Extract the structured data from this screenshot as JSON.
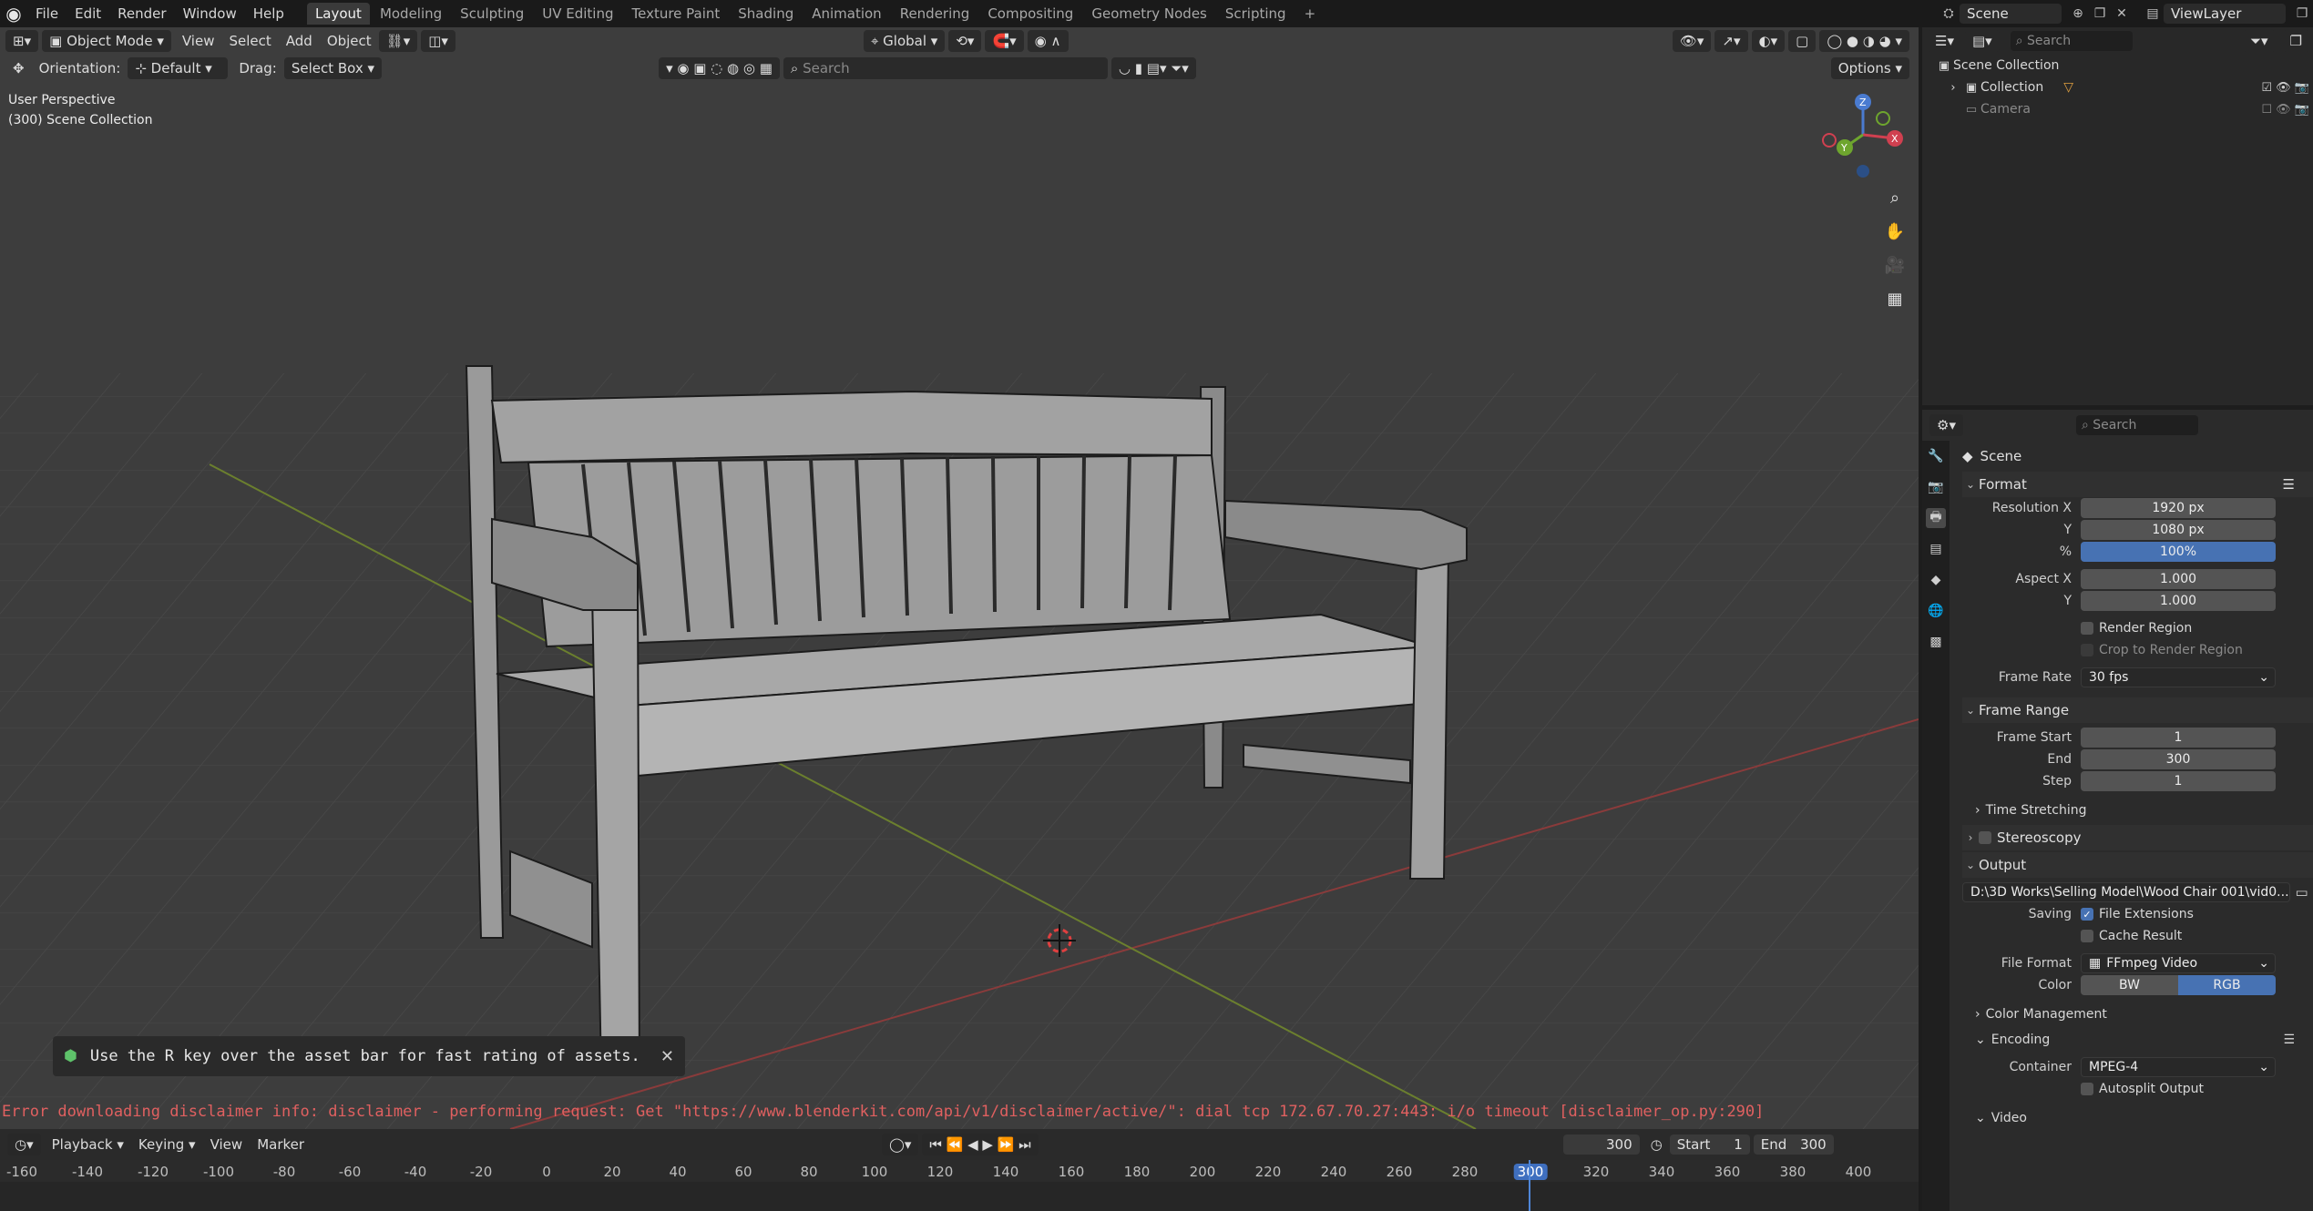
{
  "topbar": {
    "menus": [
      "File",
      "Edit",
      "Render",
      "Window",
      "Help"
    ],
    "workspaces": [
      "Layout",
      "Modeling",
      "Sculpting",
      "UV Editing",
      "Texture Paint",
      "Shading",
      "Animation",
      "Rendering",
      "Compositing",
      "Geometry Nodes",
      "Scripting",
      "+"
    ],
    "active_workspace": "Layout",
    "scene": "Scene",
    "view_layer": "ViewLayer"
  },
  "viewport": {
    "mode": "Object Mode",
    "menus": [
      "View",
      "Select",
      "Add",
      "Object"
    ],
    "transform": "Global",
    "orientation_label": "Orientation:",
    "orientation_value": "Default",
    "drag_label": "Drag:",
    "drag_value": "Select Box",
    "search_placeholder": "Search",
    "options": "Options",
    "perspective": "User Perspective",
    "collection": "(300) Scene Collection"
  },
  "notice": {
    "text": "Use the R key over the asset bar for fast rating of assets.",
    "close": "✕"
  },
  "error": "Error downloading disclaimer info: disclaimer - performing request: Get \"https://www.blenderkit.com/api/v1/disclaimer/active/\": dial tcp 172.67.70.27:443: i/o timeout [disclaimer_op.py:290]",
  "timeline": {
    "menus": [
      "Playback",
      "Keying",
      "View",
      "Marker"
    ],
    "current_frame": "300",
    "start_label": "Start",
    "start": "1",
    "end_label": "End",
    "end": "300",
    "ticks": [
      "-160",
      "-140",
      "-120",
      "-100",
      "-80",
      "-60",
      "-40",
      "-20",
      "0",
      "20",
      "40",
      "60",
      "80",
      "100",
      "120",
      "140",
      "160",
      "180",
      "200",
      "220",
      "240",
      "260",
      "280",
      "300",
      "320",
      "340",
      "360",
      "380",
      "400"
    ]
  },
  "outliner": {
    "search_placeholder": "Search",
    "items": [
      {
        "label": "Scene Collection"
      },
      {
        "label": "Collection"
      },
      {
        "label": "Camera"
      }
    ]
  },
  "properties": {
    "search_placeholder": "Search",
    "title": "Scene",
    "format": {
      "label": "Format",
      "resolution_x_label": "Resolution X",
      "resolution_x": "1920 px",
      "y_label": "Y",
      "resolution_y": "1080 px",
      "pct_label": "%",
      "pct": "100%",
      "aspect_x_label": "Aspect X",
      "aspect_x": "1.000",
      "aspect_y_label": "Y",
      "aspect_y": "1.000",
      "render_region": "Render Region",
      "crop": "Crop to Render Region",
      "frame_rate_label": "Frame Rate",
      "frame_rate": "30 fps"
    },
    "frame_range": {
      "label": "Frame Range",
      "start_label": "Frame Start",
      "start": "1",
      "end_label": "End",
      "end": "300",
      "step_label": "Step",
      "step": "1",
      "time_stretching": "Time Stretching"
    },
    "stereoscopy": "Stereoscopy",
    "output": {
      "label": "Output",
      "path": "D:\\3D Works\\Selling Model\\Wood Chair 001\\vid0...",
      "saving_label": "Saving",
      "file_extensions": "File Extensions",
      "cache_result": "Cache Result",
      "file_format_label": "File Format",
      "file_format": "FFmpeg Video",
      "color_label": "Color",
      "color_bw": "BW",
      "color_rgb": "RGB",
      "color_management": "Color Management"
    },
    "encoding": {
      "label": "Encoding",
      "container_label": "Container",
      "container": "MPEG-4",
      "autosplit": "Autosplit Output"
    },
    "video": "Video"
  }
}
